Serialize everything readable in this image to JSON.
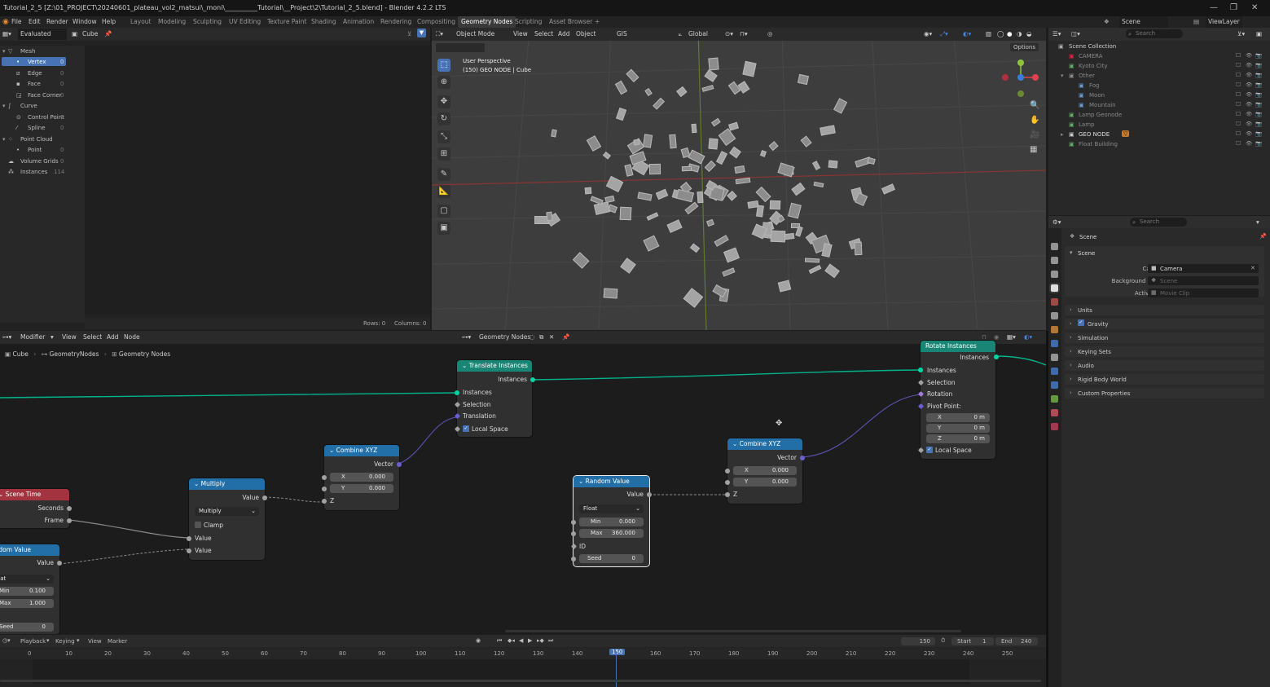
{
  "window": {
    "title": "Tutorial_2_5 [Z:\\01_PROJECT\\20240601_plateau_vol2_matsui\\_moni\\__________Tutorial\\__Project\\2\\Tutorial_2_5.blend] - Blender 4.2.2 LTS"
  },
  "menu": {
    "file": "File",
    "edit": "Edit",
    "render": "Render",
    "window": "Window",
    "help": "Help",
    "workspaces": [
      "Layout",
      "Modeling",
      "Sculpting",
      "UV Editing",
      "Texture Paint",
      "Shading",
      "Animation",
      "Rendering",
      "Compositing",
      "Geometry Nodes",
      "Scripting",
      "Asset Browser"
    ],
    "add_ws": "+",
    "scene": "Scene",
    "view_layer": "ViewLayer"
  },
  "spreadsheet": {
    "mode": "Evaluated",
    "object": "Cube",
    "items": [
      {
        "label": "Mesh",
        "count": ""
      },
      {
        "label": "Vertex",
        "count": "0"
      },
      {
        "label": "Edge",
        "count": "0"
      },
      {
        "label": "Face",
        "count": "0"
      },
      {
        "label": "Face Corner",
        "count": "0"
      },
      {
        "label": "Curve",
        "count": ""
      },
      {
        "label": "Control Point",
        "count": "0"
      },
      {
        "label": "Spline",
        "count": "0"
      },
      {
        "label": "Point Cloud",
        "count": ""
      },
      {
        "label": "Point",
        "count": "0"
      },
      {
        "label": "Volume Grids",
        "count": "0"
      },
      {
        "label": "Instances",
        "count": "114"
      }
    ],
    "rows": "Rows: 0",
    "columns": "Columns: 0"
  },
  "viewport": {
    "mode": "Object Mode",
    "menu": [
      "View",
      "Select",
      "Add",
      "Object"
    ],
    "gis": "GIS",
    "transform": "Global",
    "options": "Options",
    "perspective": "User Perspective",
    "object_info": "(150) GEO NODE | Cube"
  },
  "outliner": {
    "search_placeholder": "Search",
    "items": [
      {
        "label": "Scene Collection"
      },
      {
        "label": "CAMERA"
      },
      {
        "label": "Kyoto City"
      },
      {
        "label": "Other"
      },
      {
        "label": "Fog"
      },
      {
        "label": "Moon"
      },
      {
        "label": "Mountain"
      },
      {
        "label": "Lamp Geonode"
      },
      {
        "label": "Lamp"
      },
      {
        "label": "GEO NODE"
      },
      {
        "label": "Float Building"
      }
    ]
  },
  "properties": {
    "search_placeholder": "Search",
    "context": "Scene",
    "section": "Scene",
    "camera_label": "Camera",
    "camera_value": "Camera",
    "bg_label": "Background Scene",
    "bg_value": "Scene",
    "clip_label": "Active Clip",
    "clip_value": "Movie Clip",
    "panels": [
      "Units",
      "Gravity",
      "Simulation",
      "Keying Sets",
      "Audio",
      "Rigid Body World",
      "Custom Properties"
    ]
  },
  "node_editor": {
    "menu": [
      "Modifier",
      "View",
      "Select",
      "Add",
      "Node"
    ],
    "tree_name": "Geometry Nodes",
    "breadcrumb": [
      "Cube",
      "GeometryNodes",
      "Geometry Nodes"
    ],
    "nodes": {
      "translate": {
        "title": "Translate Instances",
        "out": "Instances",
        "in1": "Instances",
        "in2": "Selection",
        "in3": "Translation",
        "in4": "Local Space"
      },
      "rotate": {
        "title": "Rotate Instances",
        "out": "Instances",
        "in1": "Instances",
        "in2": "Selection",
        "in3": "Rotation",
        "in4": "Pivot Point:",
        "x": "X",
        "xv": "0 m",
        "y": "Y",
        "yv": "0 m",
        "z": "Z",
        "zv": "0 m",
        "local": "Local Space"
      },
      "combine1": {
        "title": "Combine XYZ",
        "out": "Vector",
        "x": "X",
        "xv": "0.000",
        "y": "Y",
        "yv": "0.000",
        "z": "Z"
      },
      "combine2": {
        "title": "Combine XYZ",
        "out": "Vector",
        "x": "X",
        "xv": "0.000",
        "y": "Y",
        "yv": "0.000",
        "z": "Z"
      },
      "random1": {
        "title": "Random Value",
        "out": "Value",
        "type": "Float",
        "min": "Min",
        "minv": "0.000",
        "max": "Max",
        "maxv": "360.000",
        "id": "ID",
        "seed": "Seed",
        "seedv": "0"
      },
      "random2": {
        "title": "Random Value",
        "out": "Value",
        "type": "Float",
        "min": "Min",
        "minv": "0.100",
        "max": "Max",
        "maxv": "1.000",
        "seed": "Seed",
        "seedv": "0"
      },
      "multiply": {
        "title": "Multiply",
        "out": "Value",
        "op": "Multiply",
        "clamp": "Clamp",
        "in1": "Value",
        "in2": "Value"
      },
      "scene_time": {
        "title": "Scene Time",
        "seconds": "Seconds",
        "frame": "Frame"
      }
    }
  },
  "timeline": {
    "menu": [
      "Playback",
      "Keying",
      "View",
      "Marker"
    ],
    "current": "150",
    "start_label": "Start",
    "start": "1",
    "end_label": "End",
    "end": "240",
    "ticks": [
      "0",
      "10",
      "20",
      "30",
      "40",
      "50",
      "60",
      "70",
      "80",
      "90",
      "100",
      "110",
      "120",
      "130",
      "140",
      "150",
      "160",
      "170",
      "180",
      "190",
      "200",
      "210",
      "220",
      "230",
      "240",
      "250"
    ],
    "current_frame": 150
  },
  "colors": {
    "accent": "#4772b3",
    "geometry_socket": "#00d6a3",
    "vector_socket": "#6a5fd1",
    "geo_header": "#198574",
    "converter_header": "#216fa6",
    "input_header": "#a3343f"
  }
}
